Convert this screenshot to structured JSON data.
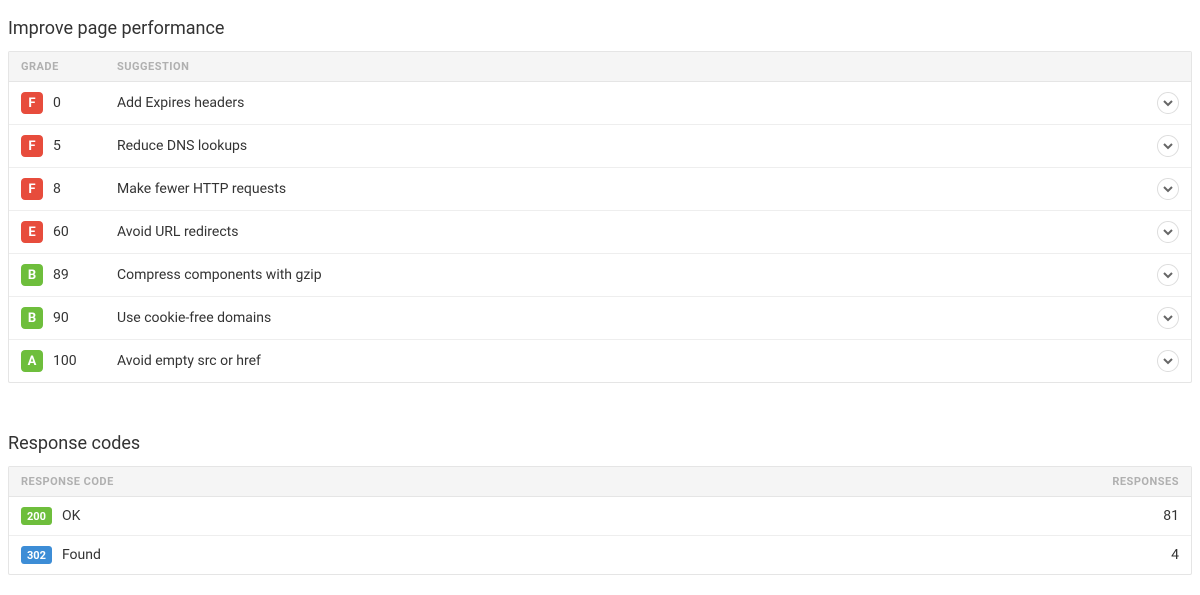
{
  "colors": {
    "grade_f": "#e74c3c",
    "grade_e": "#e74c3c",
    "grade_b": "#6ebe3c",
    "grade_a": "#6ebe3c",
    "code_200": "#6ebe3c",
    "code_302": "#3d8dd6"
  },
  "perf": {
    "title": "Improve page performance",
    "headers": {
      "grade": "GRADE",
      "suggestion": "SUGGESTION"
    },
    "rows": [
      {
        "grade": "F",
        "grade_color_key": "grade_f",
        "score": "0",
        "suggestion": "Add Expires headers"
      },
      {
        "grade": "F",
        "grade_color_key": "grade_f",
        "score": "5",
        "suggestion": "Reduce DNS lookups"
      },
      {
        "grade": "F",
        "grade_color_key": "grade_f",
        "score": "8",
        "suggestion": "Make fewer HTTP requests"
      },
      {
        "grade": "E",
        "grade_color_key": "grade_e",
        "score": "60",
        "suggestion": "Avoid URL redirects"
      },
      {
        "grade": "B",
        "grade_color_key": "grade_b",
        "score": "89",
        "suggestion": "Compress components with gzip"
      },
      {
        "grade": "B",
        "grade_color_key": "grade_b",
        "score": "90",
        "suggestion": "Use cookie-free domains"
      },
      {
        "grade": "A",
        "grade_color_key": "grade_a",
        "score": "100",
        "suggestion": "Avoid empty src or href"
      }
    ]
  },
  "resp": {
    "title": "Response codes",
    "headers": {
      "code": "RESPONSE CODE",
      "responses": "RESPONSES"
    },
    "rows": [
      {
        "code": "200",
        "code_color_key": "code_200",
        "label": "OK",
        "count": "81"
      },
      {
        "code": "302",
        "code_color_key": "code_302",
        "label": "Found",
        "count": "4"
      }
    ]
  }
}
